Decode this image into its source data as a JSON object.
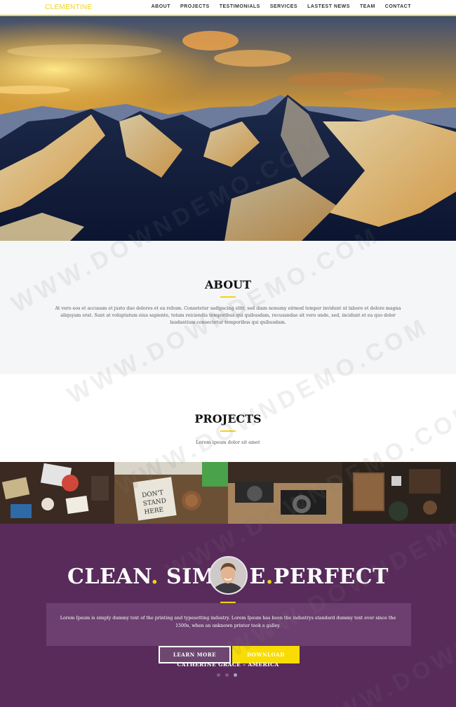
{
  "nav": {
    "brand": "CLEMENTINE",
    "items": [
      "ABOUT",
      "PROJECTS",
      "TESTIMONIALS",
      "SERVICES",
      "LASTEST NEWS",
      "TEAM",
      "CONTACT"
    ]
  },
  "about": {
    "title": "ABOUT",
    "text": "At vero eos et accusam et justo duo dolores et ea rebum. Consetetur sadipscing elitr, sed diam nonumy eirmod tempor invidunt ut labore et dolore magna aliquyam erat. Sunt at voluptatum eius sapiente, totam reiciendis temporibus qui quibusdam, recusandae sit vero unde, sed, incidunt et ea quo dolor laudantium consectetur temporibus qui quibusdam."
  },
  "projects": {
    "title": "PROJECTS",
    "subtitle": "Lorem ipsum dolor sit amet"
  },
  "testimonial": {
    "headline_part1": "CLEAN",
    "dot1": ".",
    "headline_part2": " SIM",
    "headline_part3": "E",
    "dot2": ".",
    "headline_part4": "PERFECT",
    "quote": "Lorem Ipsum is simply dummy text of the printing and typesetting industry. Lorem Ipsum has been the industrys standard dummy text ever since the 1500s, when an unknown printer took a galley.",
    "learn_more": "LEARN MORE",
    "download": "DOWNLOAD",
    "author": "CATHERINE GRACE – AMERICA"
  },
  "watermark": "WWW.DOWNDEMO.COM",
  "colors": {
    "accent": "#f2d21c",
    "purple": "#582b5b",
    "download": "#f8dc04"
  }
}
